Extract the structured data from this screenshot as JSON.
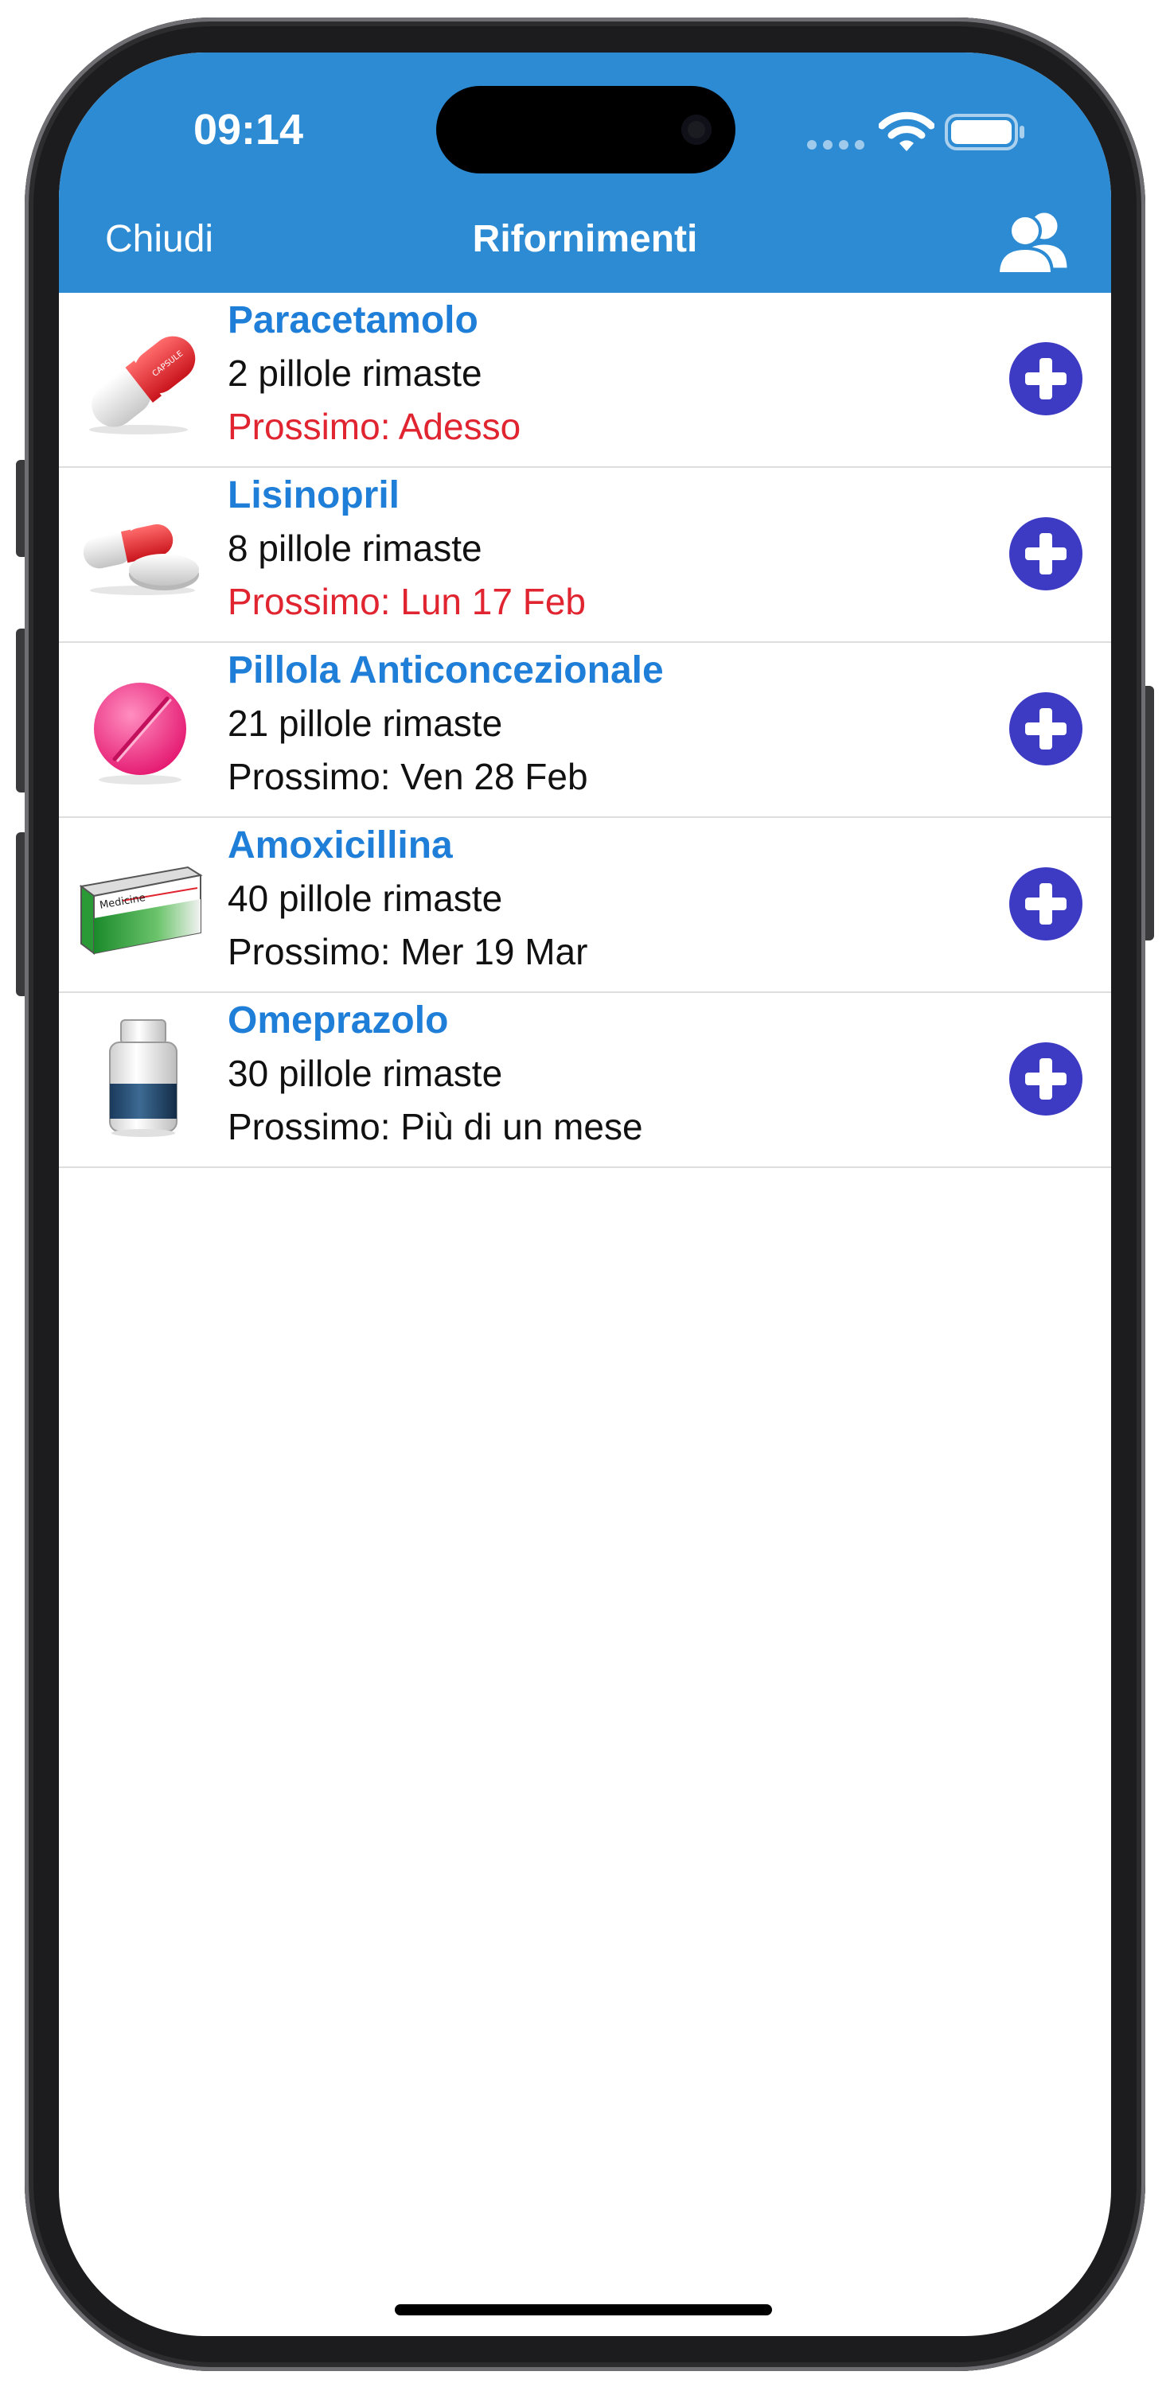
{
  "status_bar": {
    "time": "09:14"
  },
  "nav": {
    "close_label": "Chiudi",
    "title": "Rifornimenti",
    "profiles_icon": "users-icon"
  },
  "colors": {
    "header": "#2d8bd4",
    "name": "#1f7fd8",
    "overdue": "#e02430",
    "add_button": "#3d3bc4"
  },
  "refills": [
    {
      "name": "Paracetamolo",
      "remaining": "2 pillole rimaste",
      "next": "Prossimo: Adesso",
      "overdue": true,
      "icon": "capsule-icon",
      "capsule_text": "CAPSULE"
    },
    {
      "name": "Lisinopril",
      "remaining": "8 pillole rimaste",
      "next": "Prossimo: Lun 17 Feb",
      "overdue": true,
      "icon": "capsule-and-tablet-icon"
    },
    {
      "name": "Pillola Anticoncezionale",
      "remaining": "21 pillole rimaste",
      "next": "Prossimo: Ven 28 Feb",
      "overdue": false,
      "icon": "pink-pill-icon"
    },
    {
      "name": "Amoxicillina",
      "remaining": "40 pillole rimaste",
      "next": "Prossimo: Mer 19 Mar",
      "overdue": false,
      "icon": "medicine-box-icon",
      "box_text": "Medicine"
    },
    {
      "name": "Omeprazolo",
      "remaining": "30 pillole rimaste",
      "next": "Prossimo: Più di un mese",
      "overdue": false,
      "icon": "pill-bottle-icon"
    }
  ]
}
